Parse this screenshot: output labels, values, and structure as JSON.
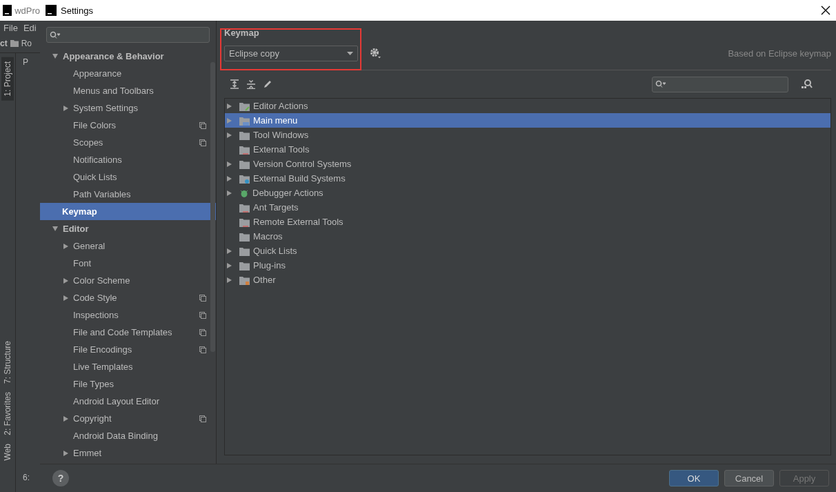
{
  "ide": {
    "title": "wdPro",
    "menu": [
      "File",
      "Edi"
    ],
    "breadcrumb": [
      "ct",
      "Ro"
    ],
    "panel_header": "P",
    "side_tabs_top": [
      {
        "label": "1: Project",
        "selected": true
      }
    ],
    "side_tabs_bottom": [
      {
        "label": "7: Structure",
        "selected": false
      },
      {
        "label": "2: Favorites",
        "selected": false
      },
      {
        "label": "Web",
        "selected": false
      }
    ],
    "bottom_tab": "6:"
  },
  "help_button": "?",
  "window": {
    "title": "Settings"
  },
  "sidebar": {
    "items": [
      {
        "label": "Appearance & Behavior",
        "selected": false,
        "expanded": true,
        "children": [
          {
            "label": "Appearance",
            "selected": false
          },
          {
            "label": "Menus and Toolbars",
            "selected": false
          },
          {
            "label": "System Settings",
            "selected": false,
            "expanded": false
          },
          {
            "label": "File Colors",
            "selected": false,
            "scoped": true
          },
          {
            "label": "Scopes",
            "selected": false,
            "scoped": true
          },
          {
            "label": "Notifications",
            "selected": false
          },
          {
            "label": "Quick Lists",
            "selected": false
          },
          {
            "label": "Path Variables",
            "selected": false
          }
        ]
      },
      {
        "label": "Keymap",
        "selected": true
      },
      {
        "label": "Editor",
        "selected": false,
        "expanded": true,
        "children": [
          {
            "label": "General",
            "selected": false,
            "expanded": false
          },
          {
            "label": "Font",
            "selected": false
          },
          {
            "label": "Color Scheme",
            "selected": false,
            "expanded": false
          },
          {
            "label": "Code Style",
            "selected": false,
            "expanded": false,
            "scoped": true
          },
          {
            "label": "Inspections",
            "selected": false,
            "scoped": true
          },
          {
            "label": "File and Code Templates",
            "selected": false,
            "scoped": true
          },
          {
            "label": "File Encodings",
            "selected": false,
            "scoped": true
          },
          {
            "label": "Live Templates",
            "selected": false
          },
          {
            "label": "File Types",
            "selected": false
          },
          {
            "label": "Android Layout Editor",
            "selected": false
          },
          {
            "label": "Copyright",
            "selected": false,
            "expanded": false,
            "scoped": true
          },
          {
            "label": "Android Data Binding",
            "selected": false
          },
          {
            "label": "Emmet",
            "selected": false,
            "expanded": false
          }
        ]
      }
    ]
  },
  "keymap": {
    "heading": "Keymap",
    "scheme": "Eclipse copy",
    "based_on": "Based on Eclipse keymap",
    "actions": [
      {
        "label": "Editor Actions",
        "kind": "editor",
        "expanded": false,
        "selected": false
      },
      {
        "label": "Main menu",
        "kind": "menu",
        "expanded": false,
        "selected": true
      },
      {
        "label": "Tool Windows",
        "kind": "folder",
        "expanded": false,
        "selected": false
      },
      {
        "label": "External Tools",
        "kind": "tools",
        "selected": false
      },
      {
        "label": "Version Control Systems",
        "kind": "folder",
        "expanded": false,
        "selected": false
      },
      {
        "label": "External Build Systems",
        "kind": "build",
        "expanded": false,
        "selected": false
      },
      {
        "label": "Debugger Actions",
        "kind": "debugger",
        "expanded": false,
        "selected": false
      },
      {
        "label": "Ant Targets",
        "kind": "tools",
        "selected": false
      },
      {
        "label": "Remote External Tools",
        "kind": "tools",
        "selected": false
      },
      {
        "label": "Macros",
        "kind": "folder",
        "selected": false
      },
      {
        "label": "Quick Lists",
        "kind": "folder",
        "expanded": false,
        "selected": false
      },
      {
        "label": "Plug-ins",
        "kind": "folder",
        "expanded": false,
        "selected": false
      },
      {
        "label": "Other",
        "kind": "other",
        "expanded": false,
        "selected": false
      }
    ]
  },
  "buttons": [
    {
      "label": "OK",
      "kind": "primary"
    },
    {
      "label": "Cancel",
      "kind": "normal"
    },
    {
      "label": "Apply",
      "kind": "disabled"
    }
  ]
}
